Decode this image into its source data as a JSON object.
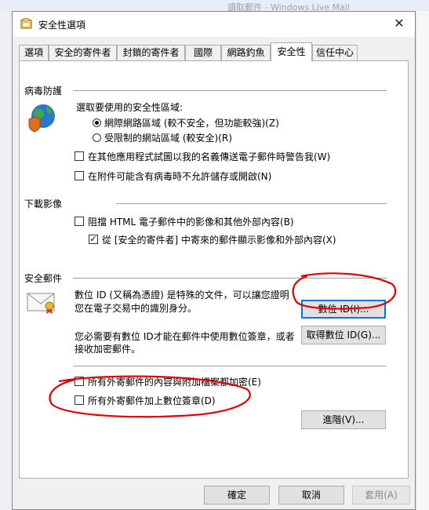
{
  "background": {
    "title": "讀取郵件 - Windows Live Mail"
  },
  "dialog": {
    "title": "安全性選項",
    "close_glyph": "✕"
  },
  "tabs": [
    {
      "label": "選項"
    },
    {
      "label": "安全的寄件者"
    },
    {
      "label": "封鎖的寄件者"
    },
    {
      "label": "國際"
    },
    {
      "label": "網路釣魚"
    },
    {
      "label": "安全性"
    },
    {
      "label": "信任中心"
    }
  ],
  "active_tab": "安全性",
  "virus": {
    "title": "病毒防護",
    "zone_prompt": "選取要使用的安全性區域:",
    "zone_internet": "網際網路區域 (較不安全，但功能較強)(Z)",
    "zone_restricted": "受限制的網站區域 (較安全)(R)",
    "zone_selected": "internet",
    "warn_other_apps": "在其他應用程式試圖以我的名義傳送電子郵件時警告我(W)",
    "warn_other_apps_checked": false,
    "block_attachments": "在附件可能含有病毒時不允許儲存或開啟(N)",
    "block_attachments_checked": false
  },
  "download": {
    "title": "下載影像",
    "block_images": "阻擋 HTML 電子郵件中的影像和其他外部內容(B)",
    "block_images_checked": false,
    "show_safe": "從 [安全的寄件者] 中寄來的郵件顯示影像和外部內容(X)",
    "show_safe_checked": true
  },
  "secure_mail": {
    "title": "安全郵件",
    "digital_id_desc_1": "數位 ID (又稱為憑證) 是特殊的文件，可以讓您證明",
    "digital_id_desc_2": "您在電子交易中的識別身分。",
    "digital_id_button": "數位 ID(I)...",
    "need_id_desc_1": "您必需要有數位 ID才能在郵件中使用數位簽章，或者",
    "need_id_desc_2": "接收加密郵件。",
    "get_id_button": "取得數位 ID(G)...",
    "encrypt_all": "所有外寄郵件的內容與附加檔案都加密(E)",
    "encrypt_all_checked": false,
    "sign_all": "所有外寄郵件加上數位簽章(D)",
    "sign_all_checked": false,
    "advanced_button": "進階(V)..."
  },
  "footer": {
    "ok": "確定",
    "cancel": "取消",
    "apply": "套用(A)"
  },
  "annotation_color": "#e00000"
}
